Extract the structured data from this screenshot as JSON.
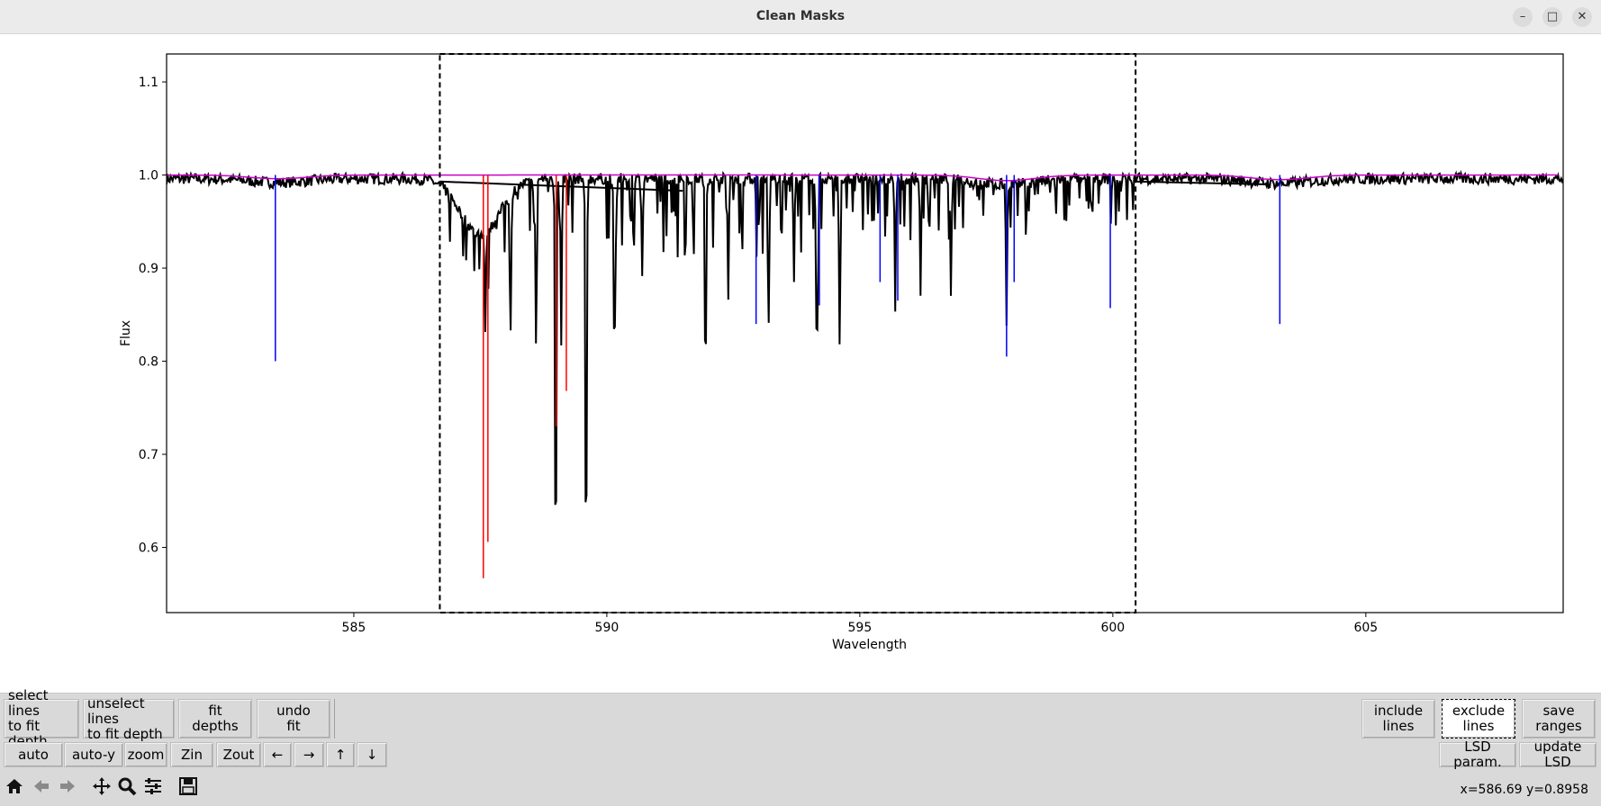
{
  "window": {
    "title": "Clean Masks",
    "minimize_glyph": "–",
    "maximize_glyph": "□",
    "close_glyph": "✕"
  },
  "buttons": {
    "select_lines": "select lines\nto fit depth",
    "unselect_lines": "unselect lines\nto fit depth",
    "fit_depths": "fit\ndepths",
    "undo_fit": "undo\nfit",
    "include_lines": "include\nlines",
    "exclude_lines": "exclude\nlines",
    "save_ranges": "save\nranges",
    "auto": "auto",
    "auto_y": "auto-y",
    "zoom": "zoom",
    "zin": "Zin",
    "zout": "Zout",
    "left": "←",
    "right": "→",
    "up": "↑",
    "down": "↓",
    "lsd_param": "LSD param.",
    "update_lsd": "update LSD"
  },
  "nav_icons": [
    "home-icon",
    "back-arrow-icon",
    "forward-arrow-icon",
    "pan-icon",
    "zoom-magnifier-icon",
    "configure-subplots-icon",
    "save-figure-icon"
  ],
  "status": {
    "coords": "x=586.69 y=0.8958"
  },
  "chart_data": {
    "type": "line",
    "xlabel": "Wavelength",
    "ylabel": "Flux",
    "xlim": [
      581.3,
      608.9
    ],
    "ylim": [
      0.53,
      1.13
    ],
    "xticks": [
      585,
      590,
      595,
      600,
      605
    ],
    "xtick_labels": [
      "585",
      "590",
      "595",
      "600",
      "605"
    ],
    "yticks": [
      0.6,
      0.7,
      0.8,
      0.9,
      1.0,
      1.1
    ],
    "ytick_labels": [
      "0.6",
      "0.7",
      "0.8",
      "0.9",
      "1.0",
      "1.1"
    ],
    "grid": false,
    "selection_range": [
      586.7,
      600.45
    ],
    "colors": {
      "spectrum": "#000000",
      "model": "#cc00cc",
      "mask_lines": "#0000ff",
      "selected_lines": "#ff0000",
      "selection_box": "#000000"
    },
    "spectrum_absorption": [
      {
        "x": 588.99,
        "depth": 0.47
      },
      {
        "x": 589.59,
        "depth": 0.47
      },
      {
        "x": 591.95,
        "depth": 0.24
      },
      {
        "x": 589.1,
        "depth": 0.18
      },
      {
        "x": 590.15,
        "depth": 0.22
      },
      {
        "x": 588.6,
        "depth": 0.18
      },
      {
        "x": 594.15,
        "depth": 0.22
      },
      {
        "x": 594.6,
        "depth": 0.18
      },
      {
        "x": 592.4,
        "depth": 0.13
      },
      {
        "x": 593.2,
        "depth": 0.16
      },
      {
        "x": 595.7,
        "depth": 0.14
      },
      {
        "x": 596.8,
        "depth": 0.13
      },
      {
        "x": 597.9,
        "depth": 0.15
      },
      {
        "x": 588.1,
        "depth": 0.14
      },
      {
        "x": 587.6,
        "depth": 0.11
      },
      {
        "x": 590.7,
        "depth": 0.1
      },
      {
        "x": 593.7,
        "depth": 0.11
      },
      {
        "x": 596.2,
        "depth": 0.12
      }
    ],
    "blue_mask_lines": [
      {
        "x": 583.45,
        "flux": 0.8
      },
      {
        "x": 592.95,
        "flux": 0.84
      },
      {
        "x": 594.2,
        "flux": 0.86
      },
      {
        "x": 595.4,
        "flux": 0.885
      },
      {
        "x": 595.75,
        "flux": 0.865
      },
      {
        "x": 597.9,
        "flux": 0.805
      },
      {
        "x": 598.05,
        "flux": 0.885
      },
      {
        "x": 599.95,
        "flux": 0.857
      },
      {
        "x": 603.3,
        "flux": 0.84
      }
    ],
    "red_mask_lines": [
      {
        "x": 587.56,
        "flux": 0.567
      },
      {
        "x": 587.65,
        "flux": 0.606
      },
      {
        "x": 589.0,
        "flux": 0.73
      },
      {
        "x": 589.2,
        "flux": 0.768
      }
    ]
  }
}
